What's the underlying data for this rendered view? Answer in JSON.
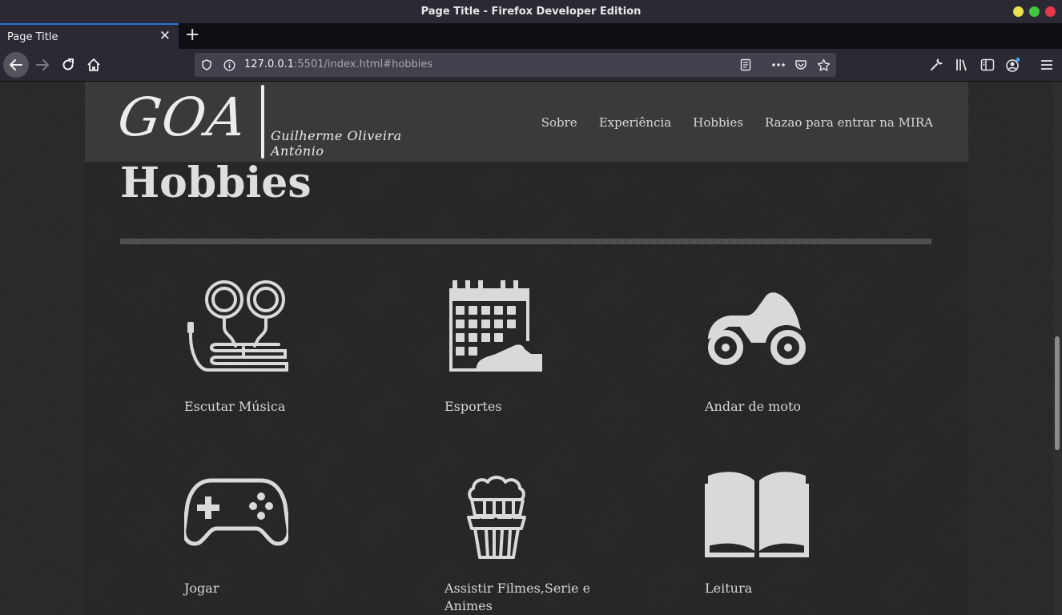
{
  "window": {
    "title": "Page Title - Firefox Developer Edition",
    "controls": [
      {
        "name": "minimize",
        "color": "#e8e04f"
      },
      {
        "name": "maximize",
        "color": "#3ec93e"
      },
      {
        "name": "close",
        "color": "#e8374a"
      }
    ]
  },
  "tabs": [
    {
      "label": "Page Title",
      "close_glyph": "✕"
    }
  ],
  "new_tab_glyph": "+",
  "url": {
    "host": "127.0.0.1",
    "rest": ":5501/index.html#hobbies"
  },
  "site": {
    "logo_mark": "GOA",
    "logo_name": "Guilherme Oliveira Antônio",
    "nav": [
      "Sobre",
      "Experiência",
      "Hobbies",
      "Razao para entrar na MIRA"
    ]
  },
  "section": {
    "title": "Hobbies"
  },
  "hobbies": [
    {
      "label": "Escutar Música",
      "icon": "earphones-icon"
    },
    {
      "label": "Esportes",
      "icon": "calendar-sneaker-icon"
    },
    {
      "label": "Andar de moto",
      "icon": "motorcycle-icon"
    },
    {
      "label": "Jogar",
      "icon": "gamepad-icon"
    },
    {
      "label": "Assistir Filmes,Serie e Animes",
      "icon": "popcorn-icon"
    },
    {
      "label": "Leitura",
      "icon": "book-icon"
    }
  ],
  "colors": {
    "icon": "#d9d9d9",
    "tab_accent": "#2a72d6"
  }
}
